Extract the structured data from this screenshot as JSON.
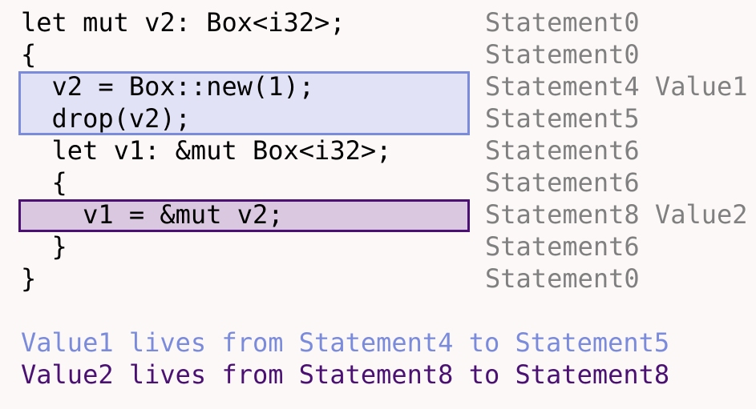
{
  "code_lines": [
    "let mut v2: Box<i32>;",
    "{",
    "  v2 = Box::new(1);",
    "  drop(v2);",
    "  let v1: &mut Box<i32>;",
    "  {",
    "    v1 = &mut v2;",
    "  }",
    "}"
  ],
  "annotations": [
    "Statement0",
    "Statement0",
    "Statement4 Value1",
    "Statement5",
    "Statement6",
    "Statement6",
    "Statement8 Value2",
    "Statement6",
    "Statement0"
  ],
  "summaries": [
    "Value1 lives from Statement4 to Statement5",
    "Value2 lives from Statement8 to Statement8"
  ],
  "colors": {
    "background": "#fcf8f7",
    "code_text": "#000000",
    "annotation_text": "#808080",
    "value1_fill": "#e2e2f7",
    "value1_border": "#7a8bdc",
    "value1_text": "#7a8bdc",
    "value2_fill": "#d9c8df",
    "value2_border": "#4a1173",
    "value2_text": "#4a1173"
  }
}
